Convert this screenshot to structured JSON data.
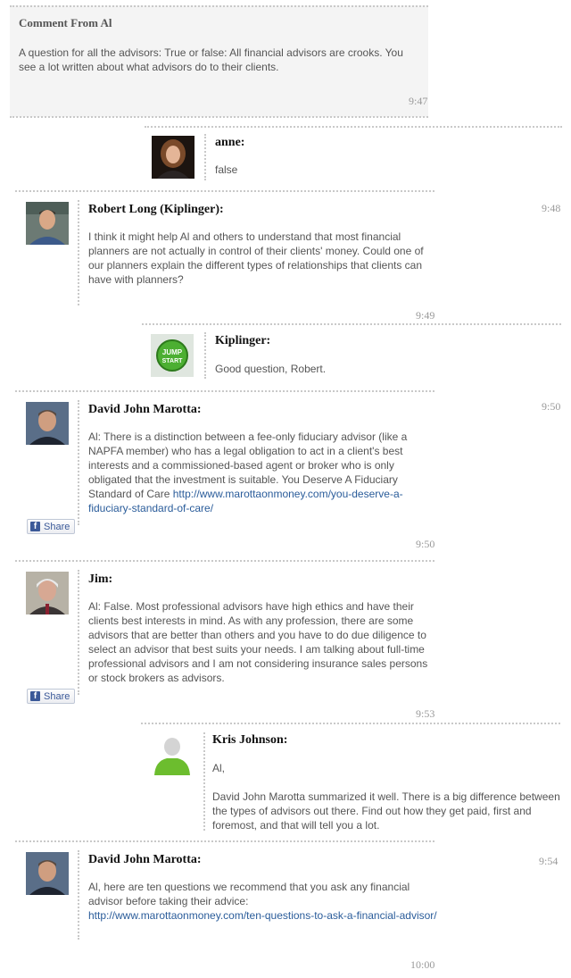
{
  "al_comment": {
    "title": "Comment From Al",
    "text": "A question for all the advisors: True or false: All financial advisors are crooks. You see a lot written about what advisors do to their clients.",
    "time": "9:47"
  },
  "anne": {
    "name": "anne:",
    "text": "false"
  },
  "robert": {
    "name": "Robert Long (Kiplinger):",
    "time": "9:48",
    "text": "I think it might help Al and others to understand that most financial planners are not actually in control of their clients' money. Could one of our planners explain the different types of relationships that clients can have with planners?",
    "time_bottom": "9:49"
  },
  "kiplinger": {
    "name": "Kiplinger:",
    "text": "Good question, Robert.",
    "logo_top": "JUMP",
    "logo_bottom": "START"
  },
  "david1": {
    "name": "David John Marotta:",
    "time": "9:50",
    "text": "Al: There is a distinction between a fee-only fiduciary advisor (like a NAPFA member) who has a legal obligation to act in a client's best interests and a commissioned-based agent or broker who is only obligated that the investment is suitable. You Deserve A Fiduciary Standard of Care ",
    "link": "http://www.marottaonmoney.com/you-deserve-a-fiduciary-standard-of-care/",
    "share": "Share",
    "time_bottom": "9:50"
  },
  "jim": {
    "name": "Jim:",
    "text": "Al: False. Most professional advisors have high ethics and have their clients best interests in mind. As with any profession, there are some advisors that are better than others and you have to do due diligence to select an advisor that best suits your needs. I am talking about full-time professional advisors and I am not considering insurance sales persons or stock brokers as advisors.",
    "share": "Share",
    "time_bottom": "9:53"
  },
  "kris": {
    "name": "Kris Johnson:",
    "greeting": "Al,",
    "text": "David John Marotta summarized it well. There is a big difference between the types of advisors out there. Find out how they get paid, first and foremost, and that will tell you a lot."
  },
  "david2": {
    "name": "David John Marotta:",
    "time": "9:54",
    "text": "Al, here are ten questions we recommend that you ask any financial advisor before taking their advice:",
    "link": "http://www.marottaonmoney.com/ten-questions-to-ask-a-financial-advisor/",
    "time_bottom": "10:00"
  },
  "icons": {
    "facebook": "f"
  }
}
